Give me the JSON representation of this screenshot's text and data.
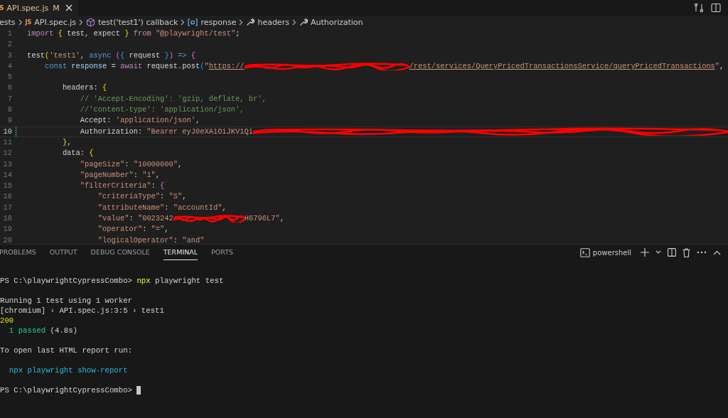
{
  "editor_tab": {
    "icon_text": "S",
    "label": "API.spec.js",
    "status": "M",
    "selected": true
  },
  "breadcrumb": [
    {
      "kind": "folder",
      "label": "ests"
    },
    {
      "kind": "file",
      "icon_text": "JS",
      "label": "API.spec.js"
    },
    {
      "kind": "method",
      "label": "test('test1') callback"
    },
    {
      "kind": "variable",
      "label": "response"
    },
    {
      "kind": "property",
      "label": "headers"
    },
    {
      "kind": "property",
      "label": "Authorization"
    }
  ],
  "code_lines": [
    {
      "number": "1",
      "current": false,
      "modified": false,
      "tokens": [
        {
          "kind": "control",
          "t": "import "
        },
        {
          "kind": "bracket1",
          "t": "{"
        },
        {
          "kind": "plain",
          "t": " test, expect "
        },
        {
          "kind": "bracket1",
          "t": "}"
        },
        {
          "kind": "control",
          "t": " from "
        },
        {
          "kind": "string",
          "t": "\"@playwright/test\""
        },
        {
          "kind": "plain",
          "t": ";"
        }
      ]
    },
    {
      "number": "2",
      "current": false,
      "modified": false
    },
    {
      "number": "3",
      "current": false,
      "modified": false,
      "tokens": [
        {
          "kind": "plain",
          "t": "test"
        },
        {
          "kind": "bracket1",
          "t": "("
        },
        {
          "kind": "string",
          "t": "'test1'"
        },
        {
          "kind": "plain",
          "t": ", "
        },
        {
          "kind": "keyword",
          "t": "async "
        },
        {
          "kind": "bracket2",
          "t": "("
        },
        {
          "kind": "bracket3",
          "t": "{"
        },
        {
          "kind": "plain",
          "t": " request "
        },
        {
          "kind": "bracket3",
          "t": "}"
        },
        {
          "kind": "bracket2",
          "t": ")"
        },
        {
          "kind": "keyword",
          "t": " => "
        },
        {
          "kind": "bracket2",
          "t": "{"
        }
      ]
    },
    {
      "number": "4",
      "current": false,
      "modified": false,
      "tokens": [
        {
          "kind": "keyword",
          "t": "    const "
        },
        {
          "kind": "variable",
          "t": "response"
        },
        {
          "kind": "plain",
          "t": " = "
        },
        {
          "kind": "control",
          "t": "await"
        },
        {
          "kind": "plain",
          "t": " request.post"
        },
        {
          "kind": "bracket3",
          "t": "("
        },
        {
          "kind": "string",
          "t": "\""
        },
        {
          "kind": "url",
          "t": "https://"
        },
        {
          "kind": "redaction-long"
        },
        {
          "kind": "url",
          "t": "/rest/services/QueryPricedTransactionsService/queryPricedTransactions"
        },
        {
          "kind": "string",
          "t": "\""
        },
        {
          "kind": "plain",
          "t": ","
        }
      ]
    },
    {
      "number": "5",
      "current": false,
      "modified": false
    },
    {
      "number": "6",
      "current": false,
      "modified": false,
      "tokens": [
        {
          "kind": "plain",
          "t": "        headers: "
        },
        {
          "kind": "bracket1",
          "t": "{"
        }
      ]
    },
    {
      "number": "7",
      "current": false,
      "modified": false,
      "tokens": [
        {
          "kind": "comment",
          "t": "            // 'Accept-Encoding': 'gzip, deflate, br',"
        }
      ]
    },
    {
      "number": "8",
      "current": false,
      "modified": false,
      "tokens": [
        {
          "kind": "comment",
          "t": "            //'content-type': 'application/json',"
        }
      ]
    },
    {
      "number": "9",
      "current": false,
      "modified": false,
      "tokens": [
        {
          "kind": "plain",
          "t": "            Accept: "
        },
        {
          "kind": "string",
          "t": "'application/json'"
        },
        {
          "kind": "plain",
          "t": ","
        }
      ]
    },
    {
      "number": "10",
      "current": true,
      "modified": true,
      "tokens": [
        {
          "kind": "plain",
          "t": "            Authorization: "
        },
        {
          "kind": "string",
          "t": "\"Bearer eyJ0eXAiOiJKV1Qi"
        },
        {
          "kind": "redaction-end"
        }
      ]
    },
    {
      "number": "11",
      "current": false,
      "modified": false,
      "tokens": [
        {
          "kind": "bracket1",
          "t": "        }"
        },
        {
          "kind": "plain",
          "t": ","
        }
      ]
    },
    {
      "number": "12",
      "current": false,
      "modified": false,
      "tokens": [
        {
          "kind": "plain",
          "t": "        data: "
        },
        {
          "kind": "bracket1",
          "t": "{"
        }
      ]
    },
    {
      "number": "13",
      "current": false,
      "modified": false,
      "tokens": [
        {
          "kind": "string",
          "t": "            \"pageSize\""
        },
        {
          "kind": "plain",
          "t": ": "
        },
        {
          "kind": "string",
          "t": "\"10000000\""
        },
        {
          "kind": "plain",
          "t": ","
        }
      ]
    },
    {
      "number": "14",
      "current": false,
      "modified": false,
      "tokens": [
        {
          "kind": "string",
          "t": "            \"pageNumber\""
        },
        {
          "kind": "plain",
          "t": ": "
        },
        {
          "kind": "string",
          "t": "\"1\""
        },
        {
          "kind": "plain",
          "t": ","
        }
      ]
    },
    {
      "number": "15",
      "current": false,
      "modified": false,
      "tokens": [
        {
          "kind": "string",
          "t": "            \"filterCriteria\""
        },
        {
          "kind": "plain",
          "t": ": "
        },
        {
          "kind": "bracket2",
          "t": "{"
        }
      ]
    },
    {
      "number": "16",
      "current": false,
      "modified": false,
      "tokens": [
        {
          "kind": "string",
          "t": "                \"criteriaType\""
        },
        {
          "kind": "plain",
          "t": ": "
        },
        {
          "kind": "string",
          "t": "\"S\""
        },
        {
          "kind": "plain",
          "t": ","
        }
      ]
    },
    {
      "number": "17",
      "current": false,
      "modified": false,
      "tokens": [
        {
          "kind": "string",
          "t": "                \"attributeName\""
        },
        {
          "kind": "plain",
          "t": ": "
        },
        {
          "kind": "string",
          "t": "\"accountId\""
        },
        {
          "kind": "plain",
          "t": ","
        }
      ]
    },
    {
      "number": "18",
      "current": false,
      "modified": false,
      "tokens": [
        {
          "kind": "string",
          "t": "                \"value\""
        },
        {
          "kind": "plain",
          "t": ": "
        },
        {
          "kind": "string",
          "t": "\"0023242"
        },
        {
          "kind": "redaction-short"
        },
        {
          "kind": "string",
          "t": "H6796L7\""
        },
        {
          "kind": "plain",
          "t": ","
        }
      ]
    },
    {
      "number": "19",
      "current": false,
      "modified": false,
      "tokens": [
        {
          "kind": "string",
          "t": "                \"operator\""
        },
        {
          "kind": "plain",
          "t": ": "
        },
        {
          "kind": "string",
          "t": "\"=\""
        },
        {
          "kind": "plain",
          "t": ","
        }
      ]
    },
    {
      "number": "20",
      "current": false,
      "modified": false,
      "tokens": [
        {
          "kind": "string",
          "t": "                \"logicalOperator\""
        },
        {
          "kind": "plain",
          "t": ": "
        },
        {
          "kind": "string",
          "t": "\"and\""
        }
      ]
    }
  ],
  "panel_tabs": [
    {
      "label": "PROBLEMS",
      "selected": false
    },
    {
      "label": "OUTPUT",
      "selected": false
    },
    {
      "label": "DEBUG CONSOLE",
      "selected": false
    },
    {
      "label": "TERMINAL",
      "selected": true
    },
    {
      "label": "PORTS",
      "selected": false
    }
  ],
  "terminal_name": "powershell",
  "terminal_blocks": [
    {
      "lines": [
        {
          "tokens": [
            {
              "kind": "plain",
              "t": "PS C:\\playwrightCypressCombo> "
            },
            {
              "kind": "exe",
              "t": "npx"
            },
            {
              "kind": "plain",
              "t": " playwright test"
            }
          ]
        }
      ]
    },
    {
      "lines": [
        {
          "tokens": [
            {
              "kind": "plain",
              "t": "Running 1 test using 1 worker"
            }
          ]
        },
        {
          "tokens": [
            {
              "kind": "plain",
              "t": "[chromium] › API.spec.js:3:5 › test1"
            }
          ]
        },
        {
          "tokens": [
            {
              "kind": "number",
              "t": "200"
            }
          ]
        },
        {
          "tokens": [
            {
              "kind": "success",
              "t": "  1 passed"
            },
            {
              "kind": "plain",
              "t": " (4.8s)"
            }
          ]
        }
      ]
    },
    {
      "lines": [
        {
          "tokens": [
            {
              "kind": "plain",
              "t": "To open last HTML report run:"
            }
          ]
        }
      ]
    },
    {
      "lines": [
        {
          "tokens": [
            {
              "kind": "info",
              "t": "  npx playwright show-report"
            }
          ]
        }
      ]
    },
    {
      "lines": [
        {
          "tokens": [
            {
              "kind": "plain",
              "t": "PS C:\\playwrightCypressCombo> "
            }
          ],
          "cursor": true
        }
      ]
    }
  ]
}
